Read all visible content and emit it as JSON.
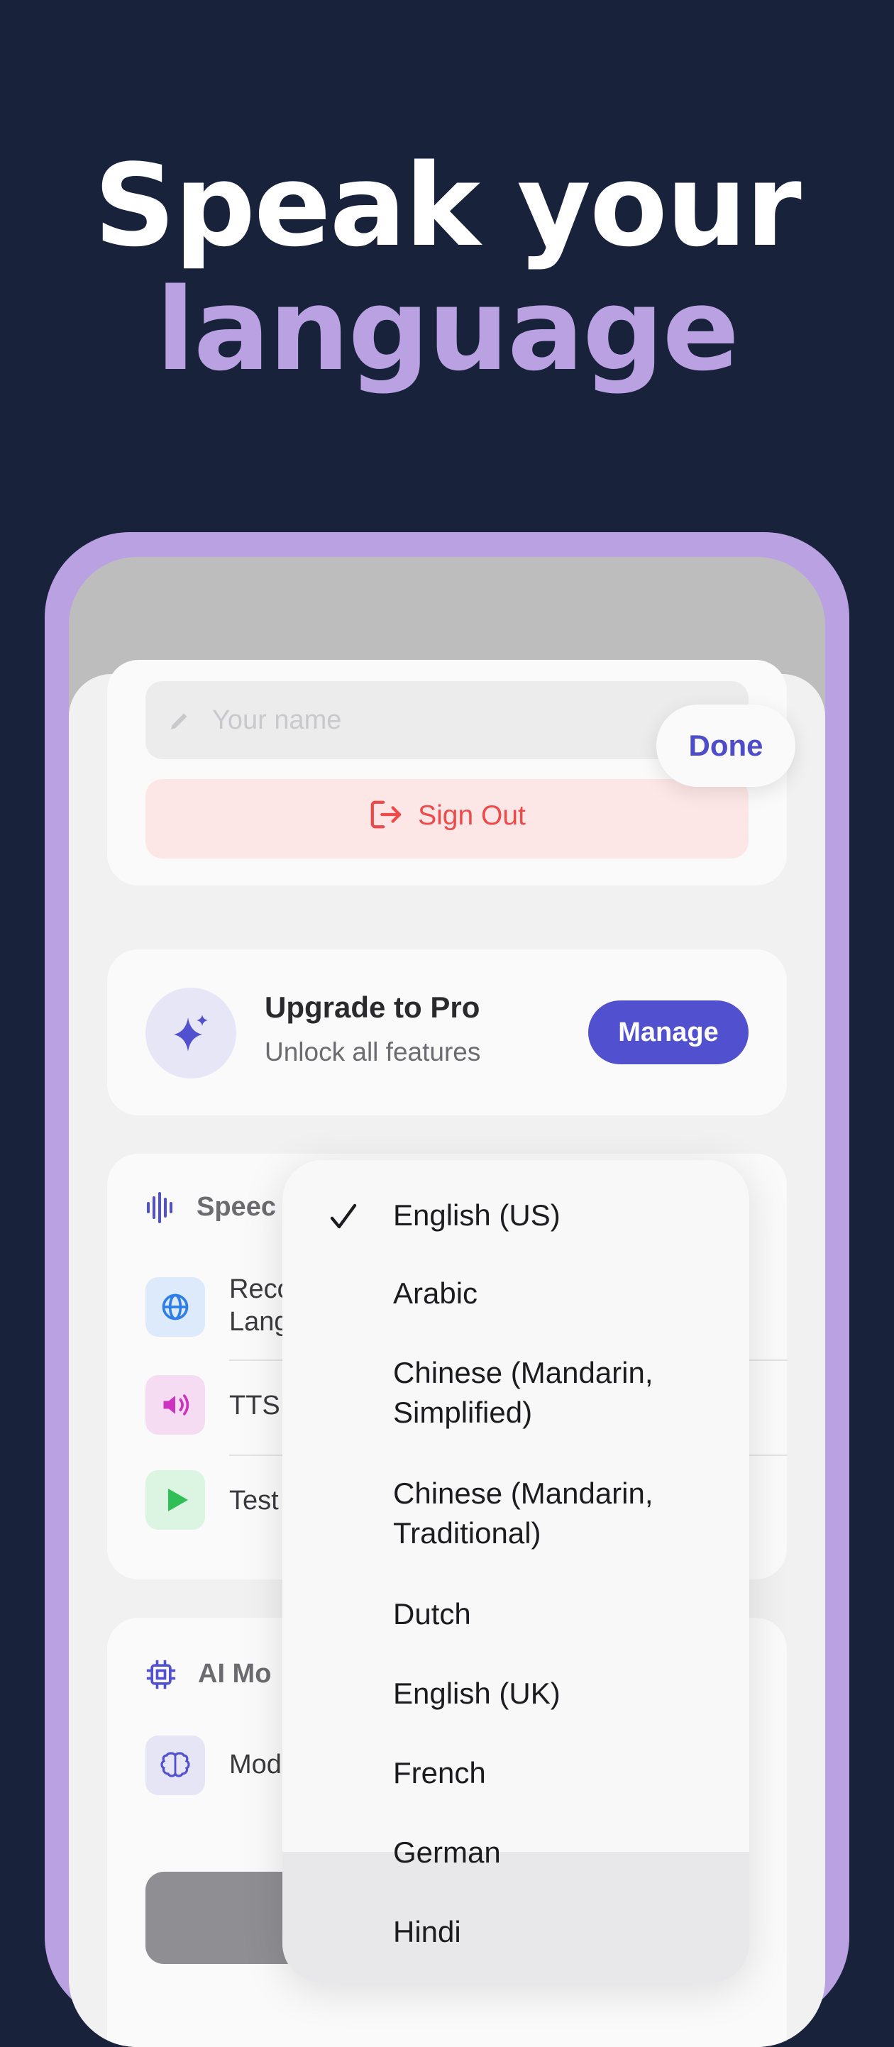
{
  "headline": {
    "line1": "Speak your",
    "line2": "language"
  },
  "profile": {
    "name_placeholder": "Your name",
    "sign_out_label": "Sign Out",
    "done_label": "Done"
  },
  "upgrade": {
    "title": "Upgrade to Pro",
    "subtitle": "Unlock all features",
    "manage_label": "Manage"
  },
  "speech_section": {
    "title": "Speec",
    "rows": [
      {
        "label": "Reco\nLang"
      },
      {
        "label": "TTS"
      },
      {
        "label": "Test"
      }
    ]
  },
  "ai_section": {
    "title": "AI Mo",
    "rows": [
      {
        "label": "Mod"
      }
    ]
  },
  "language_menu": {
    "selected": "English (US)",
    "options": [
      "English (US)",
      "Arabic",
      "Chinese (Mandarin,\nSimplified)",
      "Chinese (Mandarin,\nTraditional)",
      "Dutch",
      "English (UK)",
      "French",
      "German",
      "Hindi"
    ]
  },
  "colors": {
    "background": "#18223a",
    "accent_purple": "#b9a1e2",
    "button_indigo": "#5151cf",
    "sign_out_red": "#ef4a4a"
  }
}
